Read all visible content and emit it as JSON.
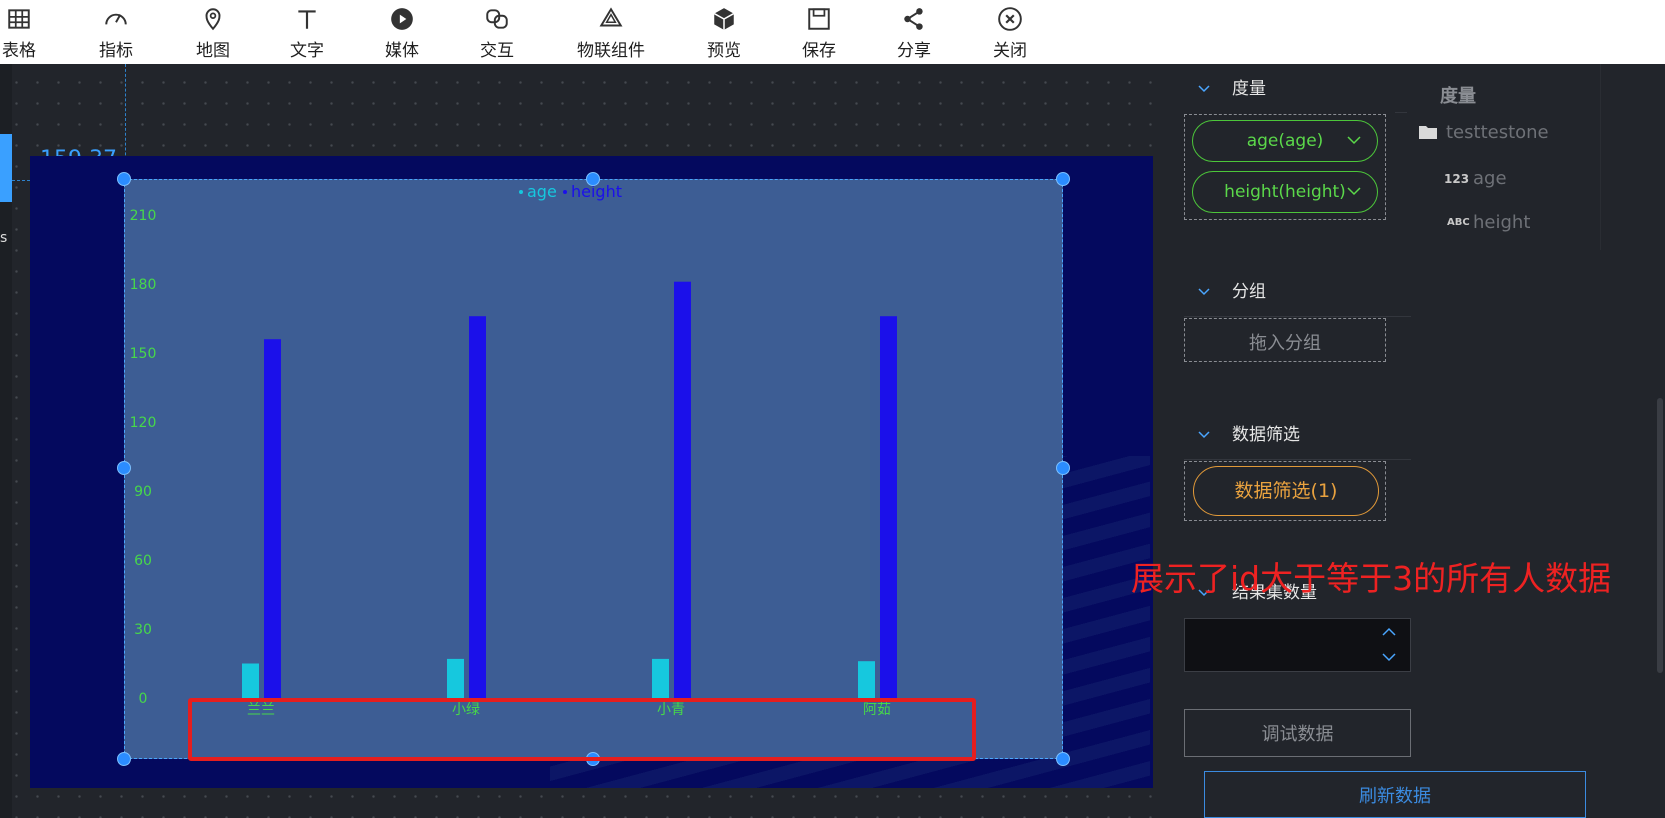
{
  "toolbar": {
    "items": [
      {
        "label": "表格",
        "icon": "table-icon"
      },
      {
        "label": "指标",
        "icon": "gauge-icon"
      },
      {
        "label": "地图",
        "icon": "map-pin-icon"
      },
      {
        "label": "文字",
        "icon": "text-icon"
      },
      {
        "label": "媒体",
        "icon": "play-icon"
      },
      {
        "label": "交互",
        "icon": "link-icon"
      },
      {
        "label": "物联组件",
        "icon": "iot-icon"
      },
      {
        "label": "预览",
        "icon": "cube-icon"
      },
      {
        "label": "保存",
        "icon": "save-icon"
      },
      {
        "label": "分享",
        "icon": "share-icon"
      },
      {
        "label": "关闭",
        "icon": "close-icon"
      }
    ]
  },
  "canvas": {
    "coords": "159,37",
    "side_mark": "s"
  },
  "chart_data": {
    "type": "bar",
    "categories": [
      "兰兰",
      "小绿",
      "小青",
      "阿茹"
    ],
    "series": [
      {
        "name": "age",
        "color": "#16c8de",
        "values": [
          15,
          17,
          17,
          16
        ]
      },
      {
        "name": "height",
        "color": "#1b10ea",
        "values": [
          156,
          166,
          181,
          166
        ]
      }
    ],
    "yticks": [
      "0",
      "30",
      "60",
      "90",
      "120",
      "150",
      "180",
      "210"
    ],
    "ylim": [
      0,
      210
    ],
    "legend": "top-center",
    "tick_color": "#47d84a"
  },
  "panel": {
    "measure": {
      "title": "度量",
      "pills": [
        "age(age)",
        "height(height)"
      ]
    },
    "group": {
      "title": "分组",
      "placeholder": "拖入分组"
    },
    "filter": {
      "title": "数据筛选",
      "pill": "数据筛选(1)"
    },
    "result_count": {
      "title": "结果集数量"
    },
    "debug_button": "调试数据",
    "refresh_button": "刷新数据"
  },
  "field_list": {
    "title": "度量",
    "dataset": "testtestone",
    "fields": [
      {
        "type": "123",
        "name": "age"
      },
      {
        "type": "ABC",
        "name": "height"
      }
    ]
  },
  "annotation": "展示了id大于等于3的所有人数据"
}
